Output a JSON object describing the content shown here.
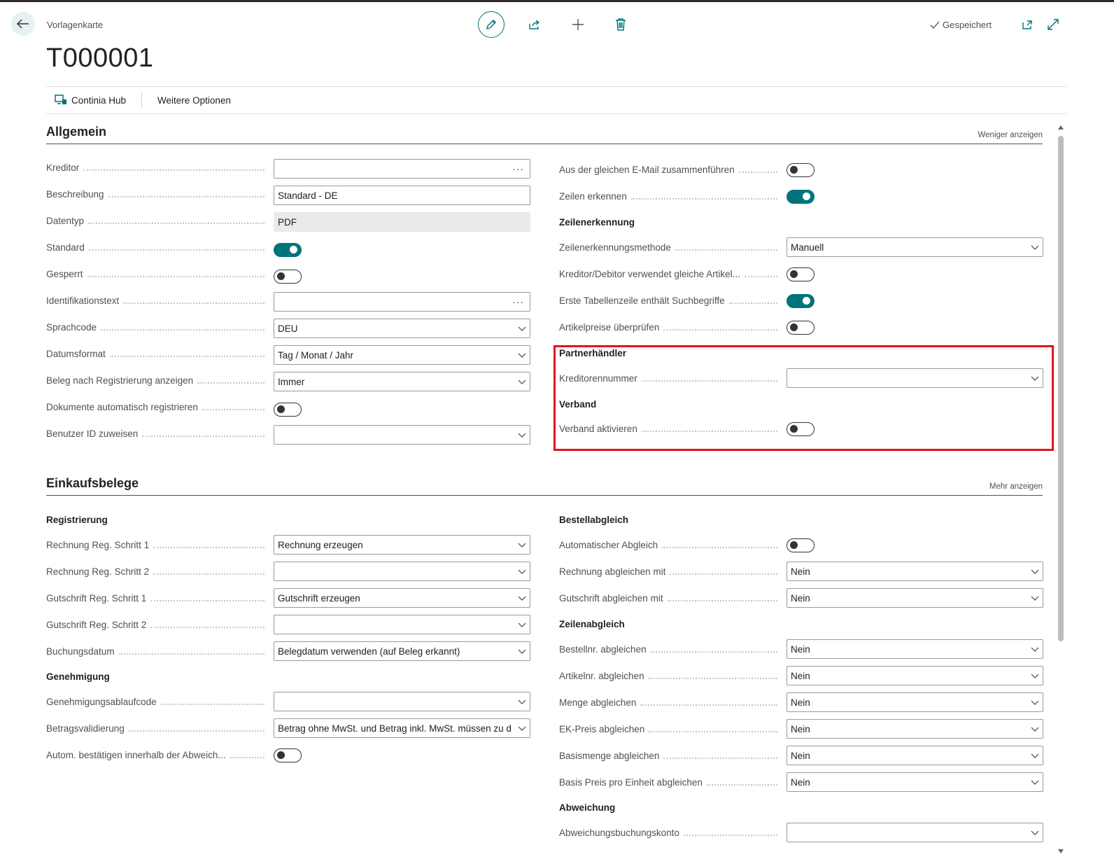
{
  "header": {
    "breadcrumb": "Vorlagenkarte",
    "title": "T000001",
    "saved_label": "Gespeichert"
  },
  "actions": {
    "hub_label": "Continia Hub",
    "more_label": "Weitere Optionen"
  },
  "allgemein": {
    "title": "Allgemein",
    "toggle_link": "Weniger anzeigen",
    "left": {
      "kreditor": {
        "label": "Kreditor",
        "value": ""
      },
      "beschreibung": {
        "label": "Beschreibung",
        "value": "Standard - DE"
      },
      "datentyp": {
        "label": "Datentyp",
        "value": "PDF"
      },
      "standard": {
        "label": "Standard",
        "on": true
      },
      "gesperrt": {
        "label": "Gesperrt",
        "on": false
      },
      "identifikationstext": {
        "label": "Identifikationstext",
        "value": ""
      },
      "sprachcode": {
        "label": "Sprachcode",
        "value": "DEU"
      },
      "datumsformat": {
        "label": "Datumsformat",
        "value": "Tag / Monat / Jahr"
      },
      "beleg_anzeigen": {
        "label": "Beleg nach Registrierung anzeigen",
        "value": "Immer"
      },
      "auto_registrieren": {
        "label": "Dokumente automatisch registrieren",
        "on": false
      },
      "benutzer_id": {
        "label": "Benutzer ID zuweisen",
        "value": ""
      }
    },
    "right": {
      "email_zusammen": {
        "label": "Aus der gleichen E-Mail zusammenführen",
        "on": false
      },
      "zeilen_erkennen": {
        "label": "Zeilen erkennen",
        "on": true
      },
      "zeilenerkennung_group": "Zeilenerkennung",
      "methode": {
        "label": "Zeilenerkennungsmethode",
        "value": "Manuell"
      },
      "gleiche_artikel": {
        "label": "Kreditor/Debitor verwendet gleiche Artikel...",
        "on": false
      },
      "erste_zeile": {
        "label": "Erste Tabellenzeile enthält Suchbegriffe",
        "on": true
      },
      "artikelpreise": {
        "label": "Artikelpreise überprüfen",
        "on": false
      },
      "partner_group": "Partnerhändler",
      "kreditorennummer": {
        "label": "Kreditorennummer",
        "value": ""
      },
      "verband_group": "Verband",
      "verband_aktivieren": {
        "label": "Verband aktivieren",
        "on": false
      }
    }
  },
  "einkauf": {
    "title": "Einkaufsbelege",
    "toggle_link": "Mehr anzeigen",
    "left": {
      "registrierung_group": "Registrierung",
      "rech_schritt1": {
        "label": "Rechnung Reg. Schritt 1",
        "value": "Rechnung erzeugen"
      },
      "rech_schritt2": {
        "label": "Rechnung Reg. Schritt 2",
        "value": ""
      },
      "gut_schritt1": {
        "label": "Gutschrift Reg. Schritt 1",
        "value": "Gutschrift erzeugen"
      },
      "gut_schritt2": {
        "label": "Gutschrift Reg. Schritt 2",
        "value": ""
      },
      "buchungsdatum": {
        "label": "Buchungsdatum",
        "value": "Belegdatum verwenden (auf Beleg erkannt)"
      },
      "genehmigung_group": "Genehmigung",
      "ablaufcode": {
        "label": "Genehmigungsablaufcode",
        "value": ""
      },
      "betragsvalidierung": {
        "label": "Betragsvalidierung",
        "value": "Betrag ohne MwSt. und Betrag inkl. MwSt. müssen zu d"
      },
      "autom_bestaetigen": {
        "label": "Autom. bestätigen innerhalb der Abweich...",
        "on": false
      }
    },
    "right": {
      "bestellabgleich_group": "Bestellabgleich",
      "auto_abgleich": {
        "label": "Automatischer Abgleich",
        "on": false
      },
      "rechnung_mit": {
        "label": "Rechnung abgleichen mit",
        "value": "Nein"
      },
      "gutschrift_mit": {
        "label": "Gutschrift abgleichen mit",
        "value": "Nein"
      },
      "zeilenabgleich_group": "Zeilenabgleich",
      "bestellnr": {
        "label": "Bestellnr. abgleichen",
        "value": "Nein"
      },
      "artikelnr": {
        "label": "Artikelnr. abgleichen",
        "value": "Nein"
      },
      "menge": {
        "label": "Menge abgleichen",
        "value": "Nein"
      },
      "ekpreis": {
        "label": "EK-Preis abgleichen",
        "value": "Nein"
      },
      "basismenge": {
        "label": "Basismenge abgleichen",
        "value": "Nein"
      },
      "basispreis": {
        "label": "Basis Preis pro Einheit abgleichen",
        "value": "Nein"
      },
      "abweichung_group": "Abweichung",
      "abweichungskonto": {
        "label": "Abweichungsbuchungskonto",
        "value": ""
      }
    }
  },
  "colors": {
    "accent": "#00747a",
    "highlight": "#e1141e"
  }
}
